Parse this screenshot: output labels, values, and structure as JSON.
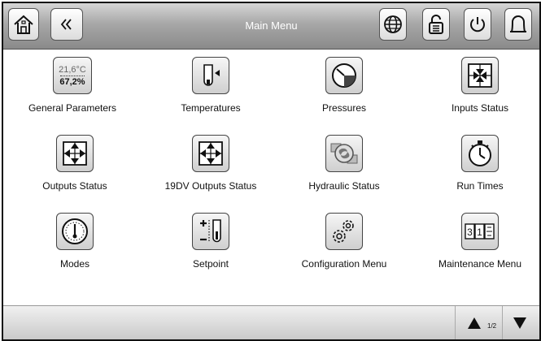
{
  "header": {
    "title": "Main Menu"
  },
  "params": {
    "temp": "21,6°C",
    "humidity": "67,2%"
  },
  "menu": [
    {
      "label": "General Parameters",
      "icon": "parameters-icon"
    },
    {
      "label": "Temperatures",
      "icon": "thermometer-icon"
    },
    {
      "label": "Pressures",
      "icon": "gauge-icon"
    },
    {
      "label": "Inputs Status",
      "icon": "inputs-icon"
    },
    {
      "label": "Outputs Status",
      "icon": "outputs-icon"
    },
    {
      "label": "19DV Outputs Status",
      "icon": "outputs-19dv-icon"
    },
    {
      "label": "Hydraulic Status",
      "icon": "hydraulic-icon"
    },
    {
      "label": "Run Times",
      "icon": "stopwatch-icon"
    },
    {
      "label": "Modes",
      "icon": "modes-gauge-icon"
    },
    {
      "label": "Setpoint",
      "icon": "setpoint-icon"
    },
    {
      "label": "Configuration Menu",
      "icon": "gears-icon"
    },
    {
      "label": "Maintenance Menu",
      "icon": "maintenance-counter-icon"
    }
  ],
  "counter": {
    "d1": "3",
    "d2": "1"
  },
  "pager": {
    "text": "1/2"
  }
}
